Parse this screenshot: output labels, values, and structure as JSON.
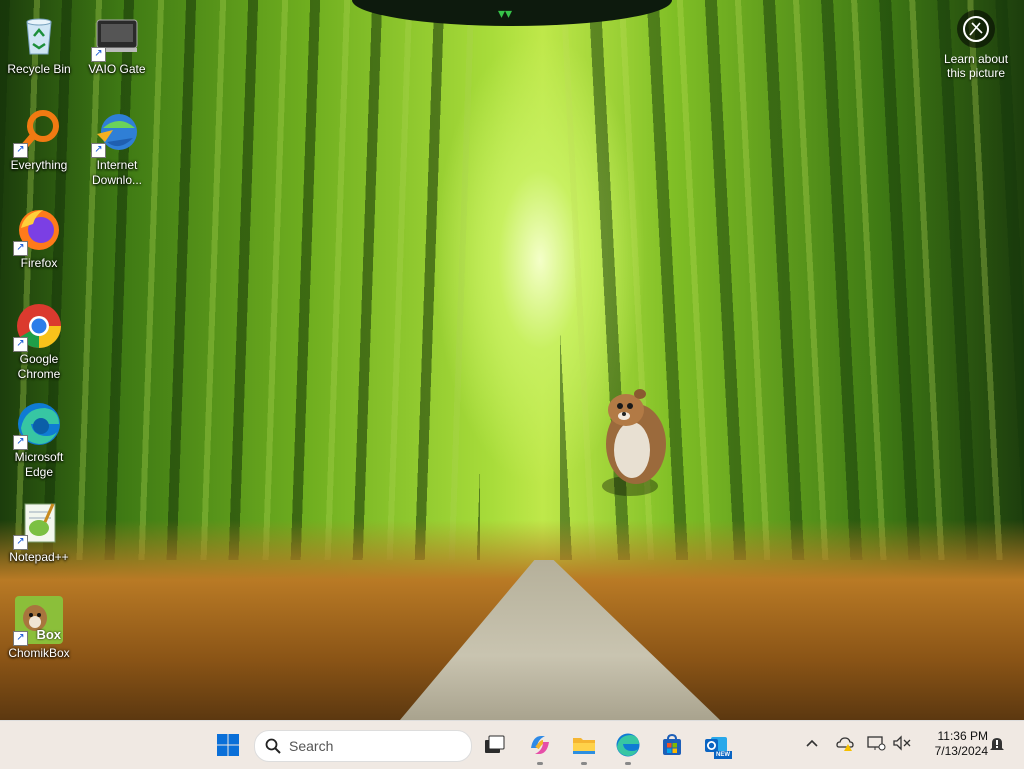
{
  "desktop": {
    "icons": [
      {
        "label": "Recycle Bin",
        "icon": "recycle-bin-icon"
      },
      {
        "label": "VAIO Gate",
        "icon": "vaio-gate-icon"
      },
      {
        "label": "Everything",
        "icon": "everything-search-icon"
      },
      {
        "label": "Internet Downlo...",
        "icon": "internet-download-manager-icon"
      },
      {
        "label": "Firefox",
        "icon": "firefox-icon"
      },
      {
        "label": "Google Chrome",
        "icon": "chrome-icon"
      },
      {
        "label": "Microsoft Edge",
        "icon": "edge-icon"
      },
      {
        "label": "Notepad++",
        "icon": "notepad-plus-plus-icon"
      },
      {
        "label": "ChomikBox",
        "icon": "chomikbox-icon",
        "badge": "Box"
      }
    ],
    "learn_about": "Learn about this picture"
  },
  "taskbar": {
    "search_label": "Search",
    "apps": [
      "start-icon",
      "task-view-icon",
      "copilot-icon",
      "file-explorer-icon",
      "edge-icon",
      "microsoft-store-icon",
      "outlook-new-icon"
    ],
    "outlook_badge": "NEW",
    "tray": {
      "chevron": "^",
      "time": "11:36 PM",
      "date": "7/13/2024"
    }
  },
  "colors": {
    "taskbar_bg": "#f0e9e3",
    "start_blue": "#0a6fd8"
  }
}
